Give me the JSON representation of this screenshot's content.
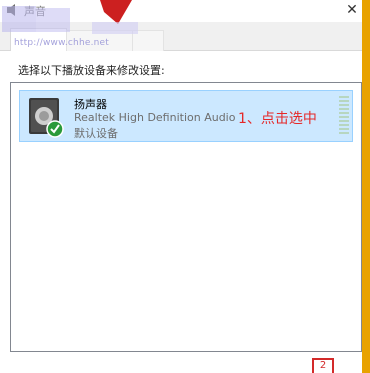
{
  "window": {
    "title": "声音",
    "close_glyph": "✕"
  },
  "watermark": {
    "url": "http://www.chhe.net"
  },
  "content": {
    "instruction": "选择以下播放设备来修改设置:"
  },
  "device": {
    "name": "扬声器",
    "driver": "Realtek High Definition Audio",
    "status": "默认设备",
    "selected": true,
    "icon": "speaker-icon",
    "status_icon": "green-check-icon"
  },
  "annotation": {
    "text": "1、点击选中"
  },
  "bottom_marker": {
    "text": "2"
  },
  "colors": {
    "selection": "#cce8ff",
    "selection_border": "#99d1ff",
    "annotation": "#e52828",
    "accent_strip": "#e8a200",
    "check": "#2b9a3a"
  }
}
